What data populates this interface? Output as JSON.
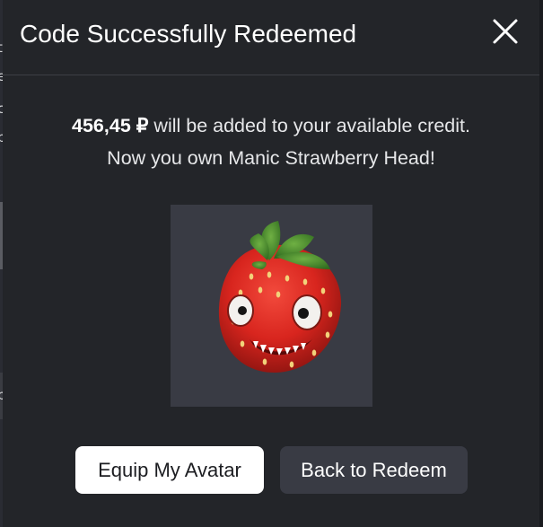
{
  "modal": {
    "title": "Code Successfully Redeemed",
    "close_icon": "close-icon",
    "message": {
      "amount": "456,45 ₽",
      "line1_rest": " will be added to your available credit.",
      "line2": "Now you own Manic Strawberry Head!"
    },
    "item": {
      "name": "Manic Strawberry Head",
      "icon": "strawberry-head-thumbnail"
    },
    "buttons": {
      "equip_label": "Equip My Avatar",
      "back_label": "Back to Redeem"
    }
  },
  "background": {
    "edge_chars": [
      "t",
      "e",
      "c",
      "b",
      "b"
    ]
  },
  "colors": {
    "modal_bg": "#232529",
    "divider": "#3d3f45",
    "thumb_bg": "#393b44",
    "primary_btn_bg": "#ffffff",
    "secondary_btn_bg": "#393b44",
    "text": "#ffffff"
  }
}
